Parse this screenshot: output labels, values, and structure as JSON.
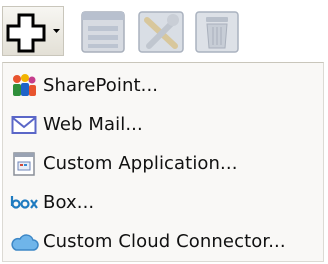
{
  "toolbar": {
    "buttons": [
      {
        "icon": "add-dropdown-icon"
      },
      {
        "icon": "storage-icon"
      },
      {
        "icon": "tools-icon"
      },
      {
        "icon": "trash-icon"
      }
    ]
  },
  "menu": {
    "items": [
      {
        "label": "SharePoint...",
        "icon": "sharepoint-icon"
      },
      {
        "label": "Web Mail...",
        "icon": "envelope-icon"
      },
      {
        "label": "Custom Application...",
        "icon": "application-icon"
      },
      {
        "label": "Box...",
        "icon": "box-logo-icon"
      },
      {
        "label": "Custom Cloud Connector...",
        "icon": "cloud-icon"
      }
    ]
  },
  "colors": {
    "menu_background": "#f9f8f6",
    "box_brand": "#1f7bc0",
    "cloud": "#5aa7e0",
    "envelope": "#5b67c8"
  }
}
